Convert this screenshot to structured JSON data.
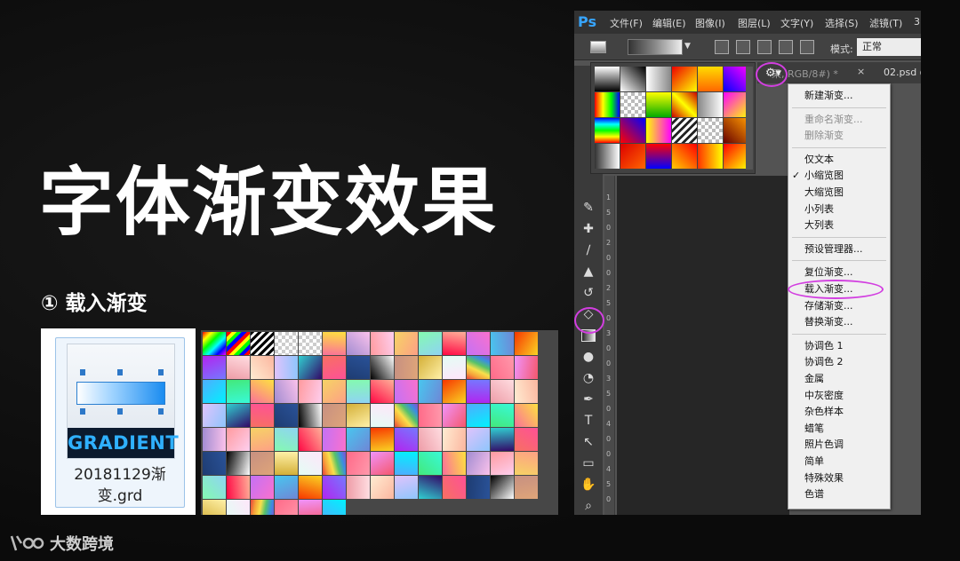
{
  "slide": {
    "title": "字体渐变效果",
    "step": "① 载入渐变",
    "watermark": "大数跨境"
  },
  "file": {
    "name": "20181129渐变.grd",
    "icon_label": "GRADIENT"
  },
  "photoshop": {
    "logo": "Ps",
    "menu": [
      "文件(F)",
      "编辑(E)",
      "图像(I)",
      "图层(L)",
      "文字(Y)",
      "选择(S)",
      "滤镜(T)",
      "3"
    ],
    "options_bar": {
      "mode_label": "模式:",
      "mode_value": "正常"
    },
    "tabs": {
      "active_fragment": "果, RGB/8#) *",
      "close": "×",
      "next_tab": "02.psd @"
    },
    "gear_icon": "gear-icon",
    "ruler_labels": [
      "1",
      "5",
      "0",
      "2",
      "0",
      "0",
      "2",
      "5",
      "0",
      "3",
      "0",
      "0",
      "3",
      "5",
      "0",
      "4",
      "0",
      "0",
      "4",
      "5",
      "0"
    ],
    "context_menu": {
      "groups": [
        [
          {
            "label": "新建渐变...",
            "enabled": true
          }
        ],
        [
          {
            "label": "重命名渐变...",
            "enabled": false
          },
          {
            "label": "删除渐变",
            "enabled": false
          }
        ],
        [
          {
            "label": "仅文本",
            "enabled": true
          },
          {
            "label": "小缩览图",
            "enabled": true,
            "checked": true
          },
          {
            "label": "大缩览图",
            "enabled": true
          },
          {
            "label": "小列表",
            "enabled": true
          },
          {
            "label": "大列表",
            "enabled": true
          }
        ],
        [
          {
            "label": "预设管理器...",
            "enabled": true
          }
        ],
        [
          {
            "label": "复位渐变...",
            "enabled": true
          },
          {
            "label": "载入渐变...",
            "enabled": true,
            "highlighted": true
          },
          {
            "label": "存储渐变...",
            "enabled": true
          },
          {
            "label": "替换渐变...",
            "enabled": true
          }
        ],
        [
          {
            "label": "协调色 1",
            "enabled": true
          },
          {
            "label": "协调色 2",
            "enabled": true
          },
          {
            "label": "金属",
            "enabled": true
          },
          {
            "label": "中灰密度",
            "enabled": true
          },
          {
            "label": "杂色样本",
            "enabled": true
          },
          {
            "label": "蜡笔",
            "enabled": true
          },
          {
            "label": "照片色调",
            "enabled": true
          },
          {
            "label": "简单",
            "enabled": true
          },
          {
            "label": "特殊效果",
            "enabled": true
          },
          {
            "label": "色谱",
            "enabled": true
          }
        ]
      ],
      "checkmark": "✓"
    },
    "highlight_color": "#d23ee0"
  },
  "colors": {
    "background": "#0d0d0d",
    "ps_blue": "#37a5ff",
    "highlight": "#d23ee0"
  }
}
